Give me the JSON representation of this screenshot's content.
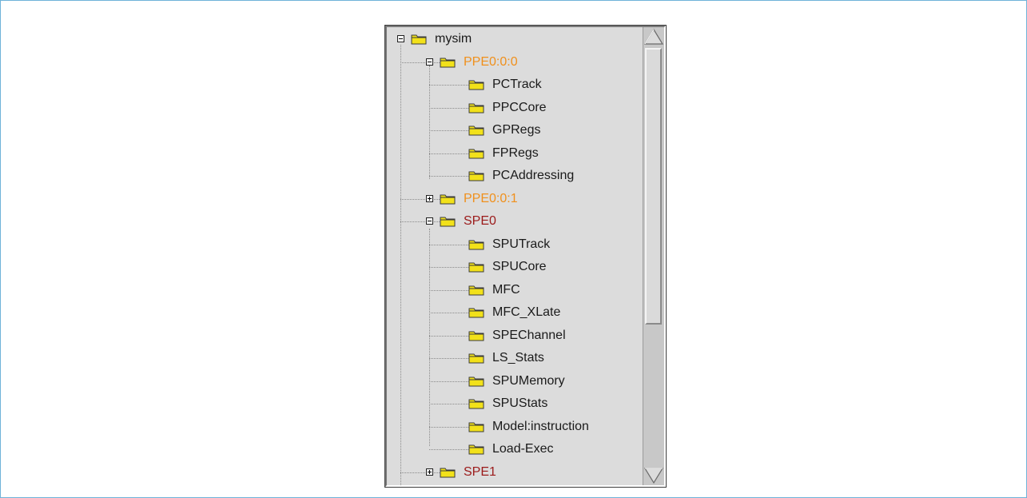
{
  "tree": {
    "nodes": [
      {
        "label": "mysim",
        "toggle": "minus",
        "kind": "root"
      },
      {
        "label": "PPE0:0:0",
        "toggle": "minus",
        "kind": "ppe"
      },
      {
        "label": "PCTrack",
        "kind": "leaf"
      },
      {
        "label": "PPCCore",
        "kind": "leaf"
      },
      {
        "label": "GPRegs",
        "kind": "leaf"
      },
      {
        "label": "FPRegs",
        "kind": "leaf"
      },
      {
        "label": "PCAddressing",
        "kind": "leaf"
      },
      {
        "label": "PPE0:0:1",
        "toggle": "plus",
        "kind": "ppe"
      },
      {
        "label": "SPE0",
        "toggle": "minus",
        "kind": "spe"
      },
      {
        "label": "SPUTrack",
        "kind": "leaf"
      },
      {
        "label": "SPUCore",
        "kind": "leaf"
      },
      {
        "label": "MFC",
        "kind": "leaf"
      },
      {
        "label": "MFC_XLate",
        "kind": "leaf"
      },
      {
        "label": "SPEChannel",
        "kind": "leaf"
      },
      {
        "label": "LS_Stats",
        "kind": "leaf"
      },
      {
        "label": "SPUMemory",
        "kind": "leaf"
      },
      {
        "label": "SPUStats",
        "kind": "leaf"
      },
      {
        "label": "Model:instruction",
        "kind": "leaf"
      },
      {
        "label": "Load-Exec",
        "kind": "leaf"
      },
      {
        "label": "SPE1",
        "toggle": "plus",
        "kind": "spe"
      }
    ]
  },
  "colors": {
    "ppe_label": "#f0901c",
    "spe_label": "#9b1a1a",
    "folder_fill": "#f2e11a",
    "panel_bg": "#dcdcdc"
  },
  "icons": {
    "folder": "folder-icon",
    "expand": "plus-box-icon",
    "collapse": "minus-box-icon",
    "scroll_up": "triangle-up-icon",
    "scroll_down": "triangle-down-icon"
  }
}
